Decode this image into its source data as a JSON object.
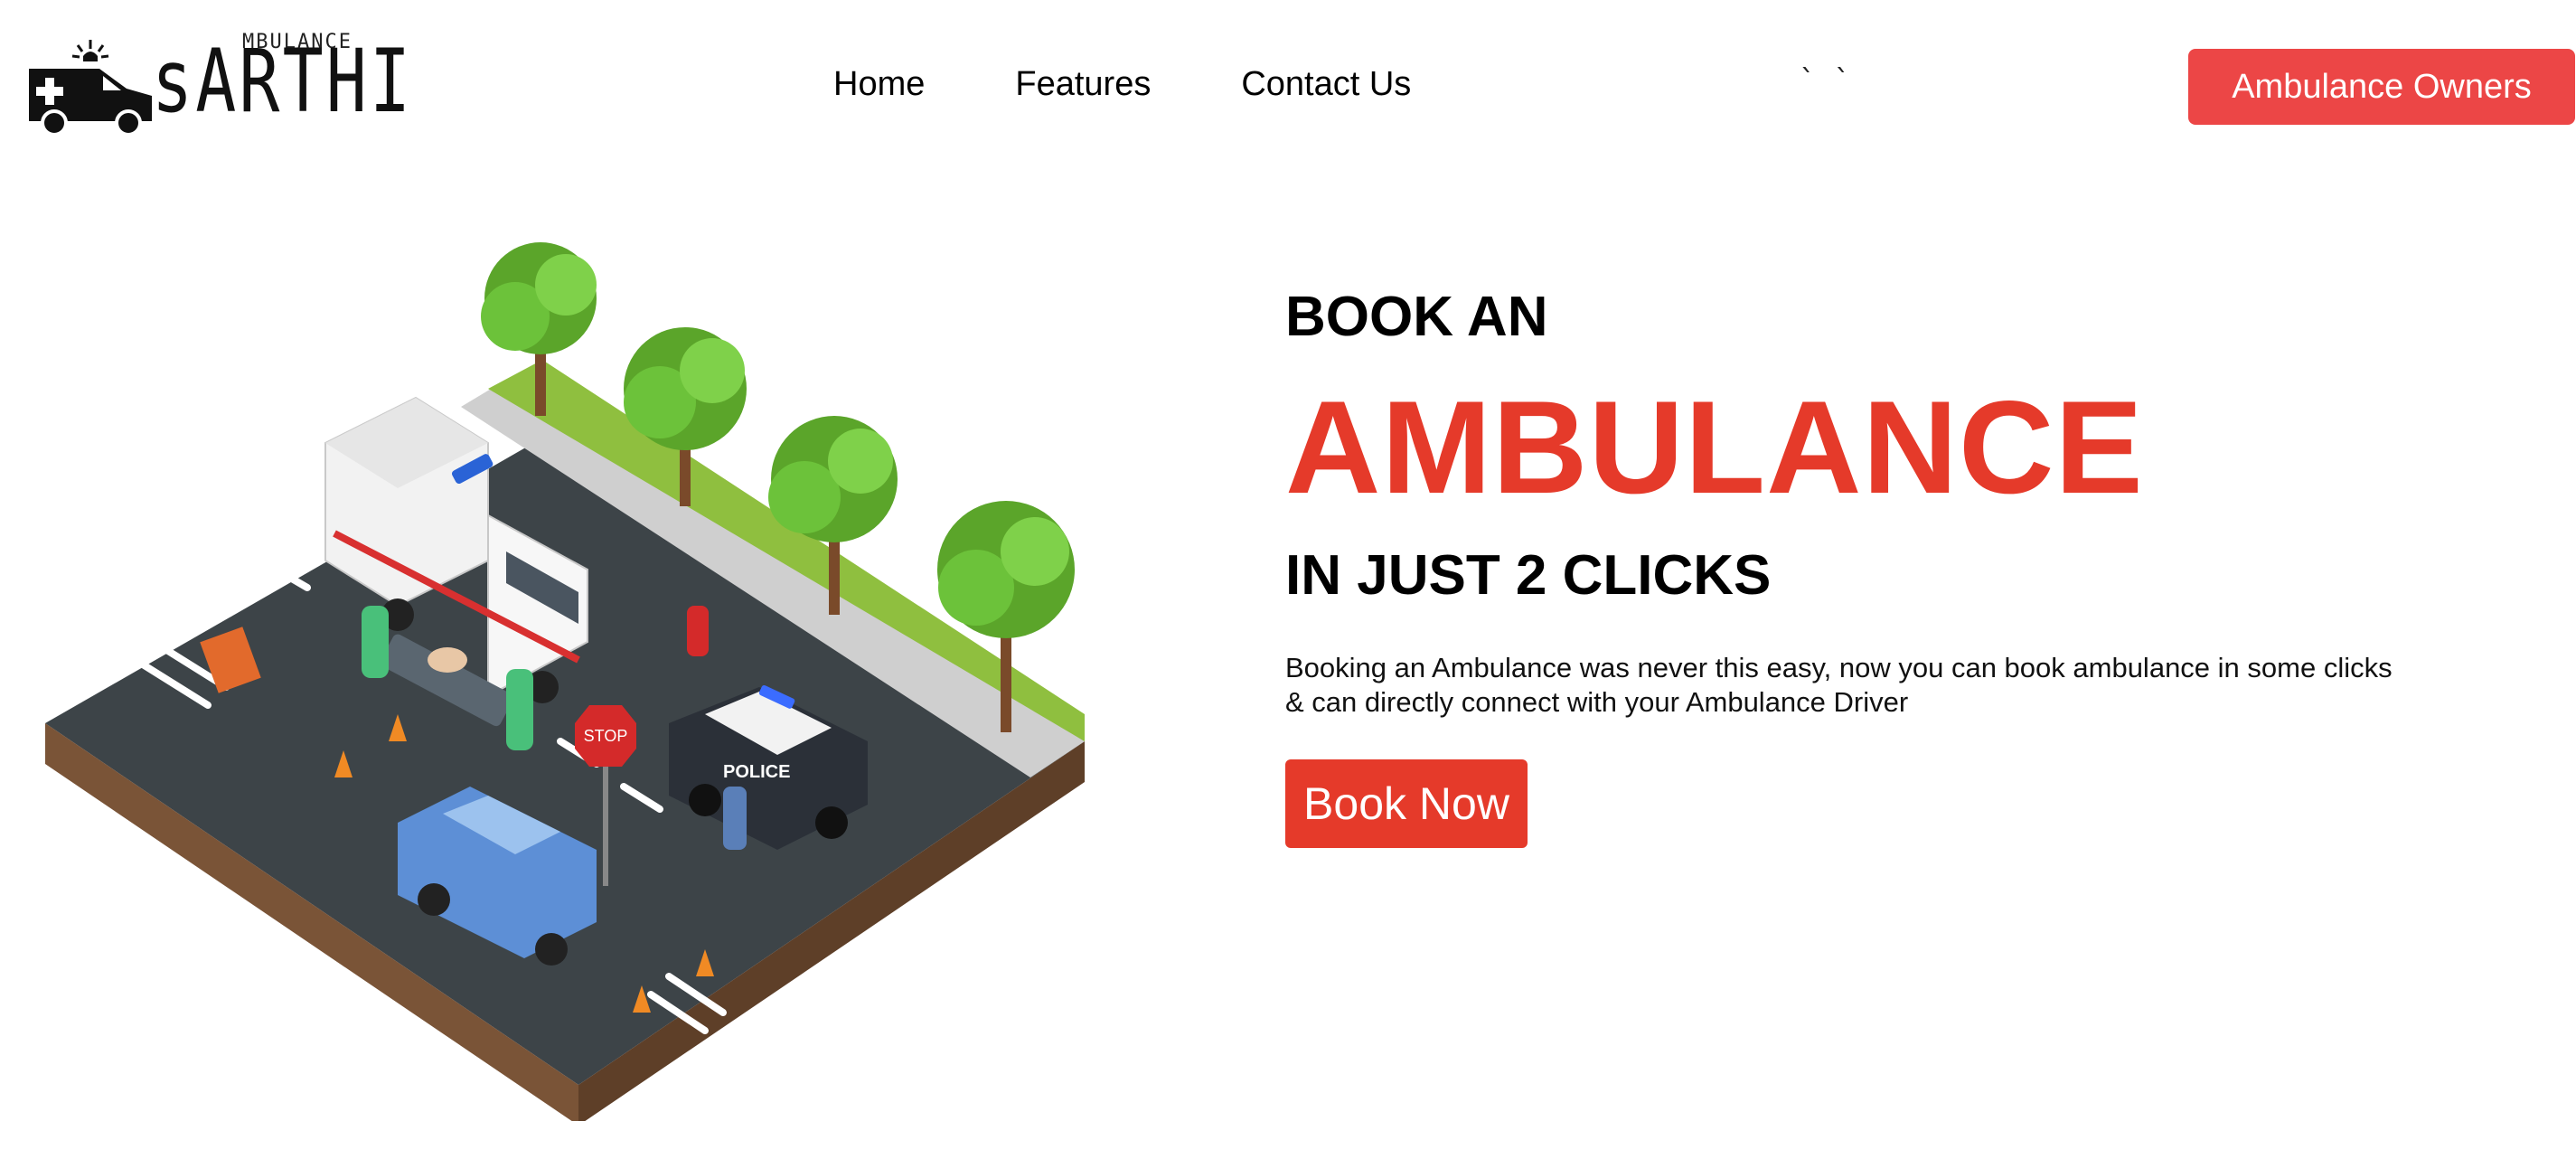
{
  "brand": {
    "small_text": "MBULANCE",
    "big_text": "sARTHI",
    "icon": "ambulance-icon"
  },
  "nav": {
    "items": [
      {
        "label": "Home"
      },
      {
        "label": "Features"
      },
      {
        "label": "Contact Us"
      }
    ],
    "stray_ticks": "` `"
  },
  "header": {
    "owners_button": "Ambulance Owners"
  },
  "hero": {
    "line1": "BOOK AN",
    "line2": "AMBULANCE",
    "line3": "IN JUST 2 CLICKS",
    "description": "Booking an Ambulance was never this easy, now you can book ambulance in some clicks & can directly connect with your Ambulance Driver",
    "cta": "Book Now",
    "illustration_stop_sign": "STOP",
    "illustration_police": "POLICE"
  },
  "colors": {
    "accent": "#e53a2a",
    "owners_button": "#ec4646"
  }
}
